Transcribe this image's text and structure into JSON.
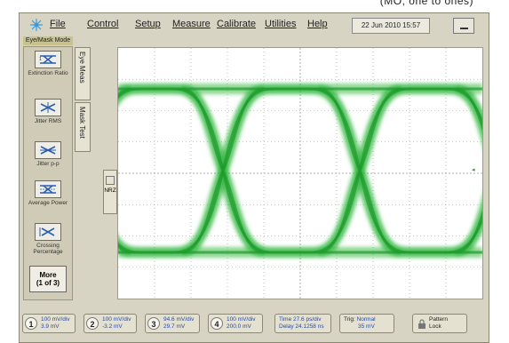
{
  "header_fragment": "(MO, one to ones)",
  "menu": {
    "items": [
      "File",
      "Control",
      "Setup",
      "Measure",
      "Calibrate",
      "Utilities",
      "Help"
    ],
    "datetime": "22 Jun 2010  15:57"
  },
  "mode_label": "Eye/Mask Mode",
  "measure_buttons": [
    "Extinction Ratio",
    "Jitter RMS",
    "Jitter p-p",
    "Average Power",
    "Crossing Percentage"
  ],
  "more_button": {
    "line1": "More",
    "line2": "(1 of 3)"
  },
  "tabs": {
    "eye_meas": "Eye Meas",
    "mask_test": "Mask Test"
  },
  "format_label": "NRZ",
  "trace_color": "#2db63a",
  "channels": [
    {
      "num": "1",
      "scale": "100 mV/div",
      "offset": "3.9 mV"
    },
    {
      "num": "2",
      "scale": "100 mV/div",
      "offset": "-3.2 mV"
    },
    {
      "num": "3",
      "scale": "94.6 mV/div",
      "offset": "29.7 mV"
    },
    {
      "num": "4",
      "scale": "100 mV/div",
      "offset": "200.0 mV"
    }
  ],
  "timebase": {
    "time": "Time 27.6 ps/div",
    "delay": "Delay 24.1258 ns"
  },
  "trigger": {
    "label": "Trig:",
    "mode": "Normal",
    "level": "35 mV"
  },
  "pattern": {
    "line1": "Pattern",
    "line2": "Lock"
  }
}
